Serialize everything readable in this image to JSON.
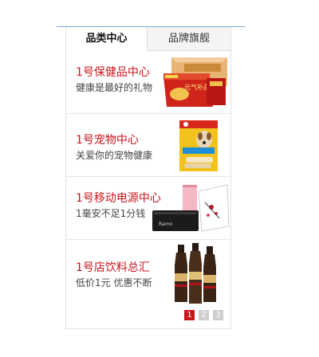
{
  "tabs": [
    {
      "label": "品类中心",
      "active": true
    },
    {
      "label": "品牌旗舰",
      "active": false
    }
  ],
  "items": [
    {
      "title": "1号保健品中心",
      "subtitle": "健康是最好的礼物",
      "image": "health-gift-boxes-image",
      "box_text": "元气补品"
    },
    {
      "title": "1号宠物中心",
      "subtitle": "关爱你的宠物健康",
      "image": "dog-treat-package-image"
    },
    {
      "title": "1号移动电源中心",
      "subtitle": "1毫安不足1分钱",
      "image": "power-bank-image",
      "device_text": "Ramo"
    },
    {
      "title": "1号店饮料总汇",
      "subtitle": "低价1元 优惠不断",
      "image": "coffee-bottles-image"
    }
  ],
  "pager": {
    "pages": [
      "1",
      "2",
      "3"
    ],
    "current": "1"
  },
  "colors": {
    "accent": "#c8161d",
    "top_line": "#7fa6cf"
  }
}
